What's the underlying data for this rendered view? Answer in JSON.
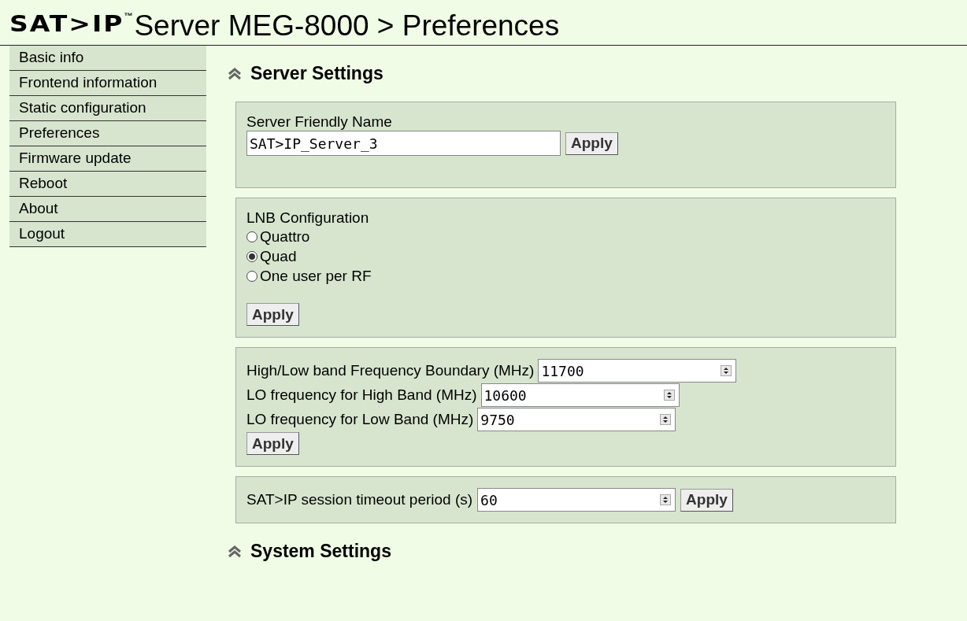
{
  "header": {
    "logo": "SAT>IP",
    "trademark": "™",
    "title": "Server MEG-8000 > Preferences"
  },
  "sidebar": {
    "items": [
      {
        "label": "Basic info",
        "selected": false
      },
      {
        "label": "Frontend information",
        "selected": false
      },
      {
        "label": "Static configuration",
        "selected": false
      },
      {
        "label": "Preferences",
        "selected": false
      },
      {
        "label": "Firmware update",
        "selected": false
      },
      {
        "label": "Reboot",
        "selected": false
      },
      {
        "label": "About",
        "selected": false
      },
      {
        "label": "Logout",
        "selected": false
      }
    ]
  },
  "sections": [
    {
      "title": "Server Settings",
      "panels": [
        {
          "kind": "text",
          "label": "Server Friendly Name",
          "value": "SAT>IP_Server_3",
          "button": "Apply"
        },
        {
          "kind": "radio",
          "label": "LNB Configuration",
          "options": [
            {
              "label": "Quattro",
              "selected": false
            },
            {
              "label": "Quad",
              "selected": true
            },
            {
              "label": "One user per RF",
              "selected": false
            }
          ],
          "button": "Apply"
        },
        {
          "kind": "numbers",
          "fields": [
            {
              "label": "High/Low band Frequency Boundary (MHz)",
              "value": "11700"
            },
            {
              "label": "LO frequency for High Band (MHz)",
              "value": "10600"
            },
            {
              "label": "LO frequency for Low Band (MHz)",
              "value": "9750"
            }
          ],
          "button": "Apply"
        },
        {
          "kind": "number_inline",
          "label": "SAT>IP session timeout period (s)",
          "value": "60",
          "button": "Apply"
        }
      ]
    },
    {
      "title": "System Settings"
    }
  ]
}
